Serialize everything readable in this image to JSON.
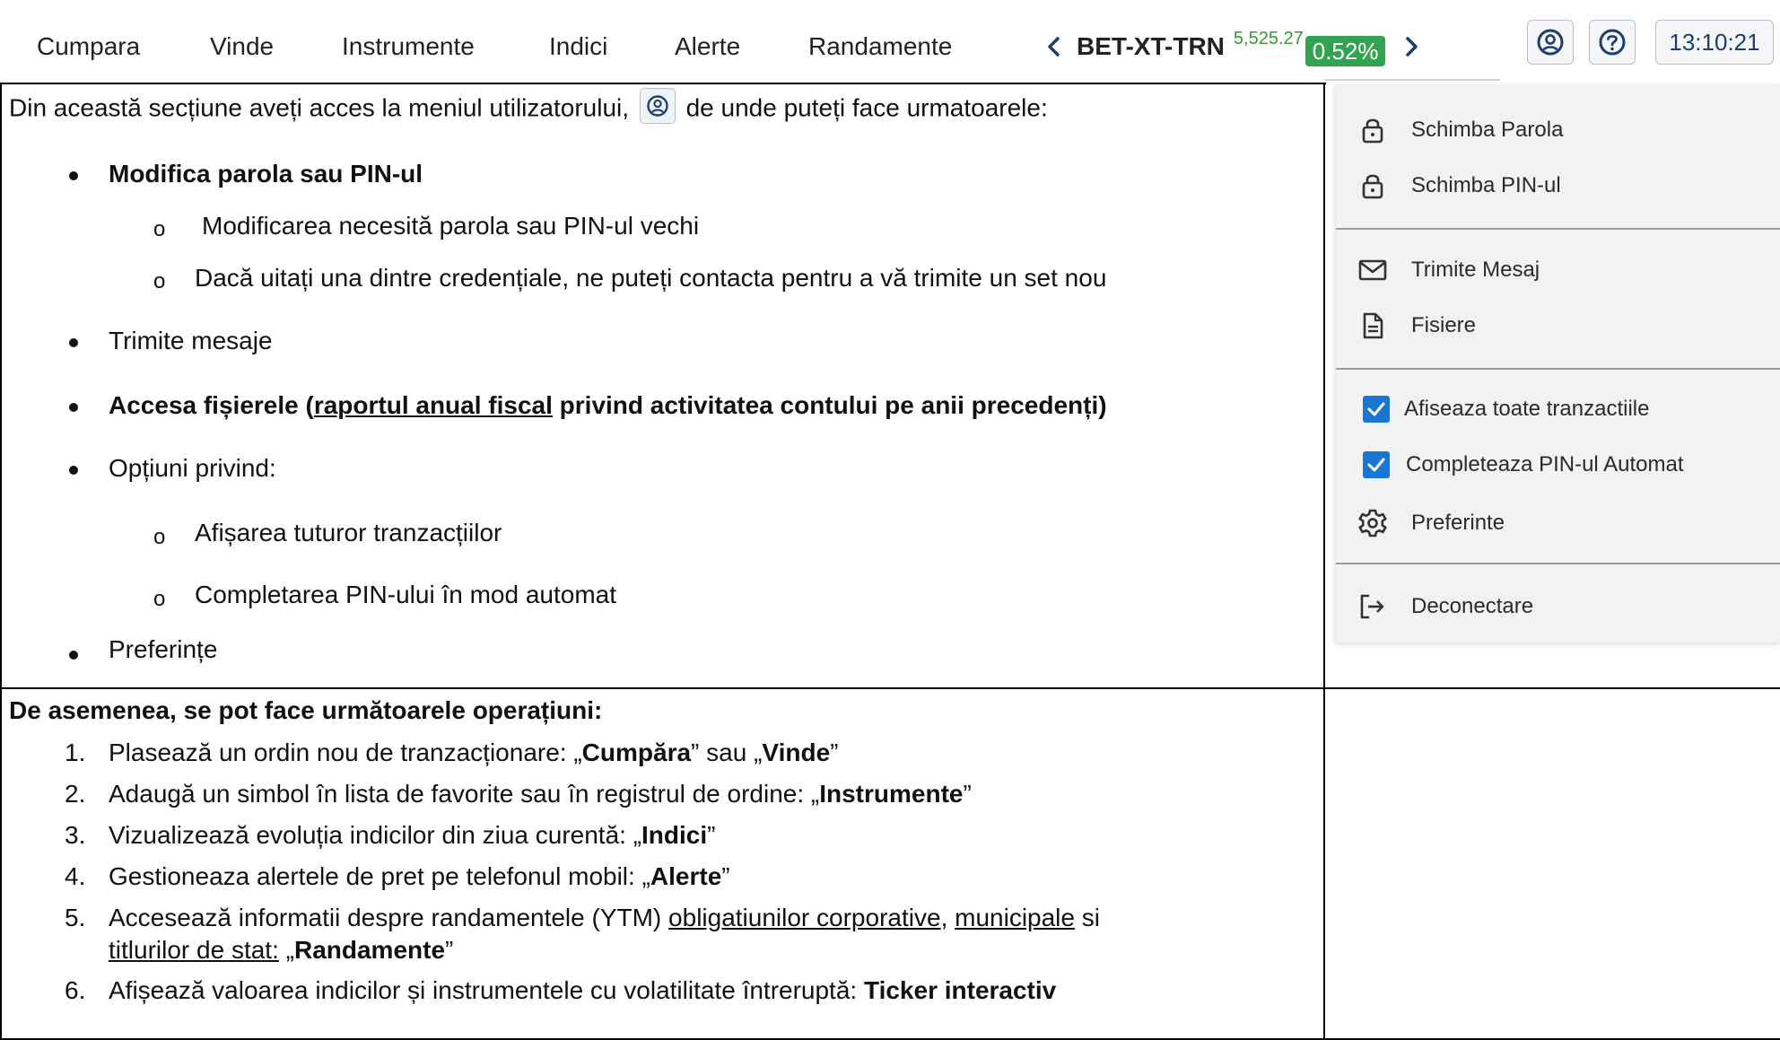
{
  "nav": {
    "items": [
      "Cumpara",
      "Vinde",
      "Instrumente",
      "Indici",
      "Alerte",
      "Randamente"
    ],
    "ticker": {
      "symbol": "BET-XT-TRN",
      "value": "5,525.27",
      "change": "0.52%",
      "change_color": "#33a351",
      "prev_icon": "chevron-left-icon",
      "next_icon": "chevron-right-icon"
    },
    "user_button_icon": "user-circle-icon",
    "help_button_icon": "help-circle-icon",
    "clock": "13:10:21"
  },
  "section1": {
    "intro_before": "Din această secțiune aveți acces la meniul utilizatorului,",
    "intro_after": "de unde puteți face urmatoarele:",
    "bullets": {
      "b1": "Modifica parola sau PIN-ul",
      "b1_sub1": "Modificarea necesită parola sau PIN-ul vechi",
      "b1_sub2": "Dacă uitați una dintre credențiale, ne puteți contacta pentru a vă trimite un set nou",
      "b2": "Trimite mesaje",
      "b3_pre": "Accesa fișierele (",
      "b3_link": "raportul anual fiscal",
      "b3_post": " privind activitatea contului pe anii precedenți)",
      "b4": "Opțiuni privind:",
      "b4_sub1": "Afișarea tuturor tranzacțiilor",
      "b4_sub2": "Completarea PIN-ului în mod automat",
      "b5": "Preferințe"
    },
    "sub_bullet_glyph": "o"
  },
  "section2": {
    "heading": "De asemenea, se pot face următoarele operațiuni:",
    "items": [
      {
        "num": "1.",
        "pre": "Plasează un ordin nou de tranzacționare: „",
        "b1": "Cumpăra",
        "mid": "” sau „",
        "b2": "Vinde",
        "post": "”"
      },
      {
        "num": "2.",
        "pre": "Adaugă un simbol în lista de favorite sau în registrul de ordine: „",
        "b1": "Instrumente",
        "post": "”"
      },
      {
        "num": "3.",
        "pre": "Vizualizează evoluția indicilor din ziua curentă: „",
        "b1": "Indici",
        "post": "”"
      },
      {
        "num": "4.",
        "pre": "Gestioneaza alertele de pret pe telefonul mobil: „",
        "b1": "Alerte",
        "post": "”"
      },
      {
        "num": "5.",
        "line1_pre": "Accesează informatii despre randamentele (YTM) ",
        "link1": "obligatiunilor corporative",
        "comma": ", ",
        "link2": "municipale",
        "si": " si",
        "link3": "titlurilor de stat:",
        "line2_mid": " „",
        "b1": "Randamente",
        "post": "”"
      },
      {
        "num": "6.",
        "pre": "Afișează valoarea indicilor și instrumentele cu volatilitate întreruptă: ",
        "b1": "Ticker interactiv"
      }
    ]
  },
  "menu": {
    "items": [
      {
        "icon": "lock-icon",
        "label": "Schimba Parola"
      },
      {
        "icon": "lock-icon",
        "label": "Schimba PIN-ul"
      },
      {
        "icon": "mail-icon",
        "label": "Trimite Mesaj"
      },
      {
        "icon": "file-icon",
        "label": "Fisiere"
      },
      {
        "checked": true,
        "label": "Afiseaza toate tranzactiile"
      },
      {
        "checked": true,
        "label": "Completeaza PIN-ul Automat"
      },
      {
        "icon": "gear-icon",
        "label": "Preferinte"
      },
      {
        "icon": "logout-icon",
        "label": "Deconectare"
      }
    ],
    "check_color": "#1976d2"
  }
}
